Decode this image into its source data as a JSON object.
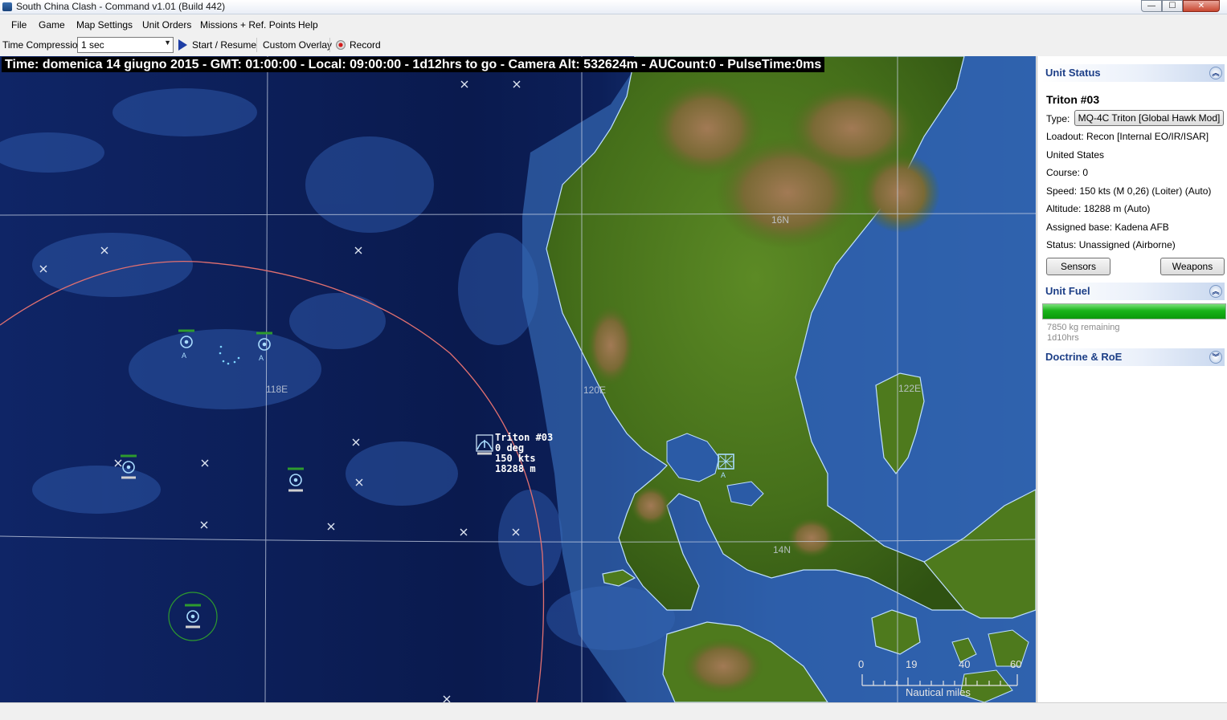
{
  "window": {
    "title": "South China Clash - Command v1.01 (Build 442)",
    "buttons": {
      "minimize": "—",
      "maximize": "☐",
      "close": "✕"
    }
  },
  "menu": [
    "File",
    "Game",
    "Map Settings",
    "Unit Orders",
    "Missions + Ref. Points",
    "Help"
  ],
  "toolbar": {
    "time_compression_label": "Time Compression:",
    "time_compression_value": "1 sec",
    "start_label": "Start / Resume",
    "custom_overlay_label": "Custom Overlay",
    "record_label": "Record"
  },
  "map": {
    "status_line": "Time: domenica 14 giugno 2015 - GMT: 01:00:00 - Local: 09:00:00 - 1d12hrs to go -  Camera Alt: 532624m - AUCount:0 - PulseTime:0ms",
    "grid_labels": [
      "118E",
      "120E",
      "122E",
      "16N",
      "14N"
    ],
    "selected_unit": {
      "name": "Triton #03",
      "course": "0 deg",
      "speed": "150 kts",
      "altitude": "18288 m"
    },
    "unit_marker_letter": "A",
    "scale": {
      "ticks": [
        "0",
        "19",
        "40",
        "60"
      ],
      "unit": "Nautical miles"
    },
    "colors": {
      "sea_deep": "#0b1c4e",
      "sea_shallow": "#2d5fa8",
      "land": "#4d7a1e",
      "range_ring": "#e06a6a",
      "unit_icon": "#9fd8ff"
    }
  },
  "panel": {
    "unit_status": {
      "header": "Unit Status",
      "unit_name": "Triton #03",
      "type_label": "Type:",
      "type_value": "MQ-4C Triton [Global Hawk Mod]",
      "loadout": "Loadout: Recon [Internal EO/IR/ISAR]",
      "side": "United States",
      "course": "Course: 0",
      "speed": "Speed: 150 kts (M 0,26) (Loiter)    (Auto)",
      "altitude": "Altitude: 18288 m    (Auto)",
      "base": "Assigned base: Kadena AFB",
      "status": "Status: Unassigned (Airborne)",
      "sensors_button": "Sensors",
      "weapons_button": "Weapons"
    },
    "unit_fuel": {
      "header": "Unit Fuel",
      "remaining": "7850 kg remaining",
      "time": "1d10hrs"
    },
    "doctrine": {
      "header": "Doctrine & RoE"
    }
  }
}
